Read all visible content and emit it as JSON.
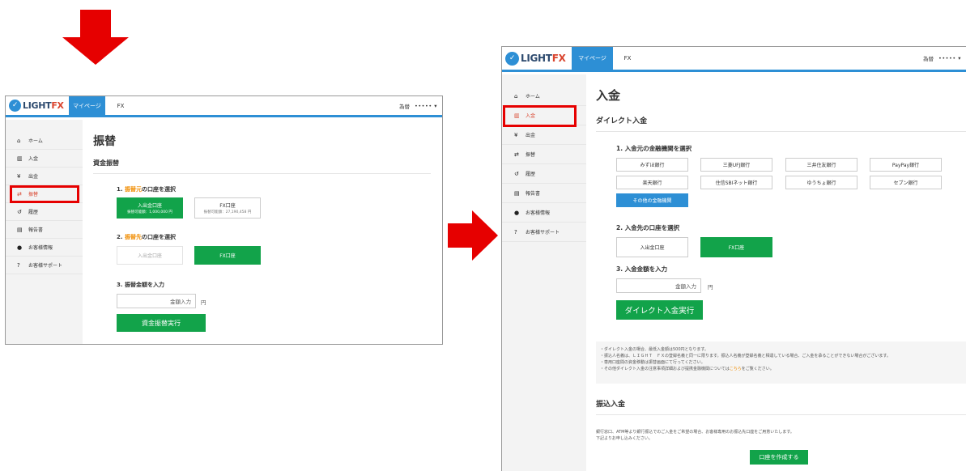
{
  "colors": {
    "accent": "#2d8fd5",
    "green": "#12a34a",
    "annotation_red": "#e60000",
    "highlight": "#f08c00"
  },
  "annotations": {
    "down_arrow": "arrow-down-icon",
    "right_arrow": "arrow-right-icon"
  },
  "header": {
    "logo_main": "LIGHT",
    "logo_fx": "FX",
    "tab_mypage": "マイページ",
    "tab_fx": "FX",
    "user_prefix": "為替",
    "user_mask": "••••• ▾"
  },
  "sidebar": {
    "items": [
      {
        "icon": "home-icon",
        "glyph": "⌂",
        "label": "ホーム"
      },
      {
        "icon": "bank-icon",
        "glyph": "▥",
        "label": "入金"
      },
      {
        "icon": "yen-icon",
        "glyph": "¥",
        "label": "出金"
      },
      {
        "icon": "transfer-icon",
        "glyph": "⇄",
        "label": "振替"
      },
      {
        "icon": "history-icon",
        "glyph": "↺",
        "label": "履歴"
      },
      {
        "icon": "report-icon",
        "glyph": "▤",
        "label": "報告書"
      },
      {
        "icon": "user-icon",
        "glyph": "●",
        "label": "お客様情報"
      },
      {
        "icon": "help-icon",
        "glyph": "?",
        "label": "お客様サポート"
      }
    ]
  },
  "transfer": {
    "title": "振替",
    "section": "資金振替",
    "step1_prefix": "1. ",
    "step1_hl": "振替元",
    "step1_suffix": "の口座を選択",
    "src_account_label": "入出金口座",
    "src_account_sub": "振替可能額：1,000,000 円",
    "fx_account_label": "FX口座",
    "fx_account_sub": "振替可能額：27,190,458 円",
    "step2_prefix": "2. ",
    "step2_hl": "振替先",
    "step2_suffix": "の口座を選択",
    "dst_in_out": "入出金口座",
    "dst_fx": "FX口座",
    "step3": "3. 振替金額を入力",
    "amount_placeholder": "金額入力",
    "unit": "円",
    "submit": "資金振替実行"
  },
  "deposit": {
    "title": "入金",
    "section_direct": "ダイレクト入金",
    "step1": "1. 入金元の金融機関を選択",
    "banks": [
      "みずほ銀行",
      "三菱UFJ銀行",
      "三井住友銀行",
      "PayPay銀行",
      "楽天銀行",
      "住信SBIネット銀行",
      "ゆうちょ銀行",
      "セブン銀行"
    ],
    "other_banks": "その他の金融機関",
    "step2": "2. 入金先の口座を選択",
    "dst_in_out": "入出金口座",
    "dst_fx": "FX口座",
    "step3": "3. 入金金額を入力",
    "amount_placeholder": "金額入力",
    "unit": "円",
    "submit": "ダイレクト入金実行",
    "notes": [
      "・ダイレクト入金の場合、最低入金額は500円となります。",
      "・振込人名義は、ＬＩＧＨＴ　ＦＸの登録名義と同一に限ります。振込人名義が登録名義と相違している場合、ご入金を承ることができない場合がございます。",
      "・専用口座間の資金移動は振替画面にて行ってください。"
    ],
    "note4_prefix": "・その他ダイレクト入金の注意事項詳細および提携金融機関については",
    "note4_link": "こちら",
    "note4_suffix": "をご覧ください。",
    "section_transfer": "振込入金",
    "transfer_text1": "銀行窓口、ATM等より銀行振込でのご入金をご希望の場合、お客様専用のお振込先口座をご用意いたします。",
    "transfer_text2": "下記よりお申し込みください。",
    "create_account": "口座を作成する"
  }
}
